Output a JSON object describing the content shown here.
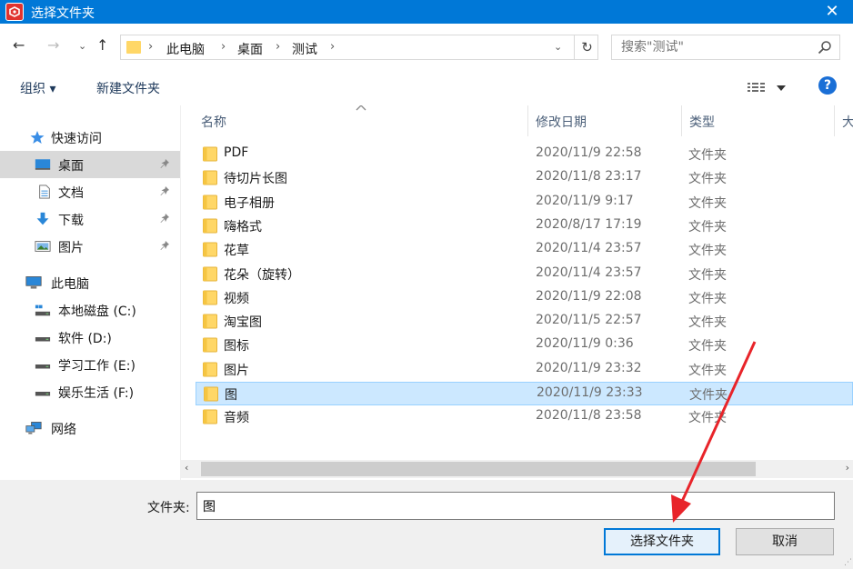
{
  "window": {
    "title": "选择文件夹",
    "close_glyph": "✕",
    "accent_color": "#0078d7"
  },
  "address_bar": {
    "back_glyph": "←",
    "forward_glyph": "→",
    "recent_glyph": "⌄",
    "up_glyph": "↑",
    "crumbs": [
      "此电脑",
      "桌面",
      "测试"
    ],
    "separator": "›",
    "dropdown_glyph": "⌄",
    "refresh_glyph": "↻"
  },
  "search": {
    "placeholder": "搜索\"测试\""
  },
  "toolbar": {
    "organize_label": "组织 ▾",
    "new_folder_label": "新建文件夹",
    "help_label": "?"
  },
  "nav": {
    "quick_access": "快速访问",
    "quick_items": [
      {
        "label": "桌面",
        "icon": "desktop-icon",
        "pinned": true,
        "selected": true
      },
      {
        "label": "文档",
        "icon": "document-icon",
        "pinned": true
      },
      {
        "label": "下载",
        "icon": "download-icon",
        "pinned": true
      },
      {
        "label": "图片",
        "icon": "picture-icon",
        "pinned": true
      }
    ],
    "this_pc": "此电脑",
    "drives": [
      "本地磁盘 (C:)",
      "软件 (D:)",
      "学习工作 (E:)",
      "娱乐生活 (F:)"
    ],
    "network": "网络",
    "pin_glyph": "📌"
  },
  "columns": {
    "name": "名称",
    "date": "修改日期",
    "type": "类型",
    "size": "大"
  },
  "files": [
    {
      "name": "PDF",
      "date": "2020/11/9 22:58",
      "type": "文件夹"
    },
    {
      "name": "待切片长图",
      "date": "2020/11/8 23:17",
      "type": "文件夹"
    },
    {
      "name": "电子相册",
      "date": "2020/11/9 9:17",
      "type": "文件夹"
    },
    {
      "name": "嗨格式",
      "date": "2020/8/17 17:19",
      "type": "文件夹"
    },
    {
      "name": "花草",
      "date": "2020/11/4 23:57",
      "type": "文件夹"
    },
    {
      "name": "花朵（旋转）",
      "date": "2020/11/4 23:57",
      "type": "文件夹"
    },
    {
      "name": "视频",
      "date": "2020/11/9 22:08",
      "type": "文件夹"
    },
    {
      "name": "淘宝图",
      "date": "2020/11/5 22:57",
      "type": "文件夹"
    },
    {
      "name": "图标",
      "date": "2020/11/9 0:36",
      "type": "文件夹"
    },
    {
      "name": "图片",
      "date": "2020/11/9 23:32",
      "type": "文件夹"
    },
    {
      "name": "图",
      "date": "2020/11/9 23:33",
      "type": "文件夹",
      "selected": true
    },
    {
      "name": "音频",
      "date": "2020/11/8 23:58",
      "type": "文件夹"
    }
  ],
  "scrollbar": {
    "left_glyph": "‹",
    "right_glyph": "›"
  },
  "footer": {
    "folder_label": "文件夹:",
    "folder_value": "图",
    "select_button": "选择文件夹",
    "cancel_button": "取消"
  }
}
